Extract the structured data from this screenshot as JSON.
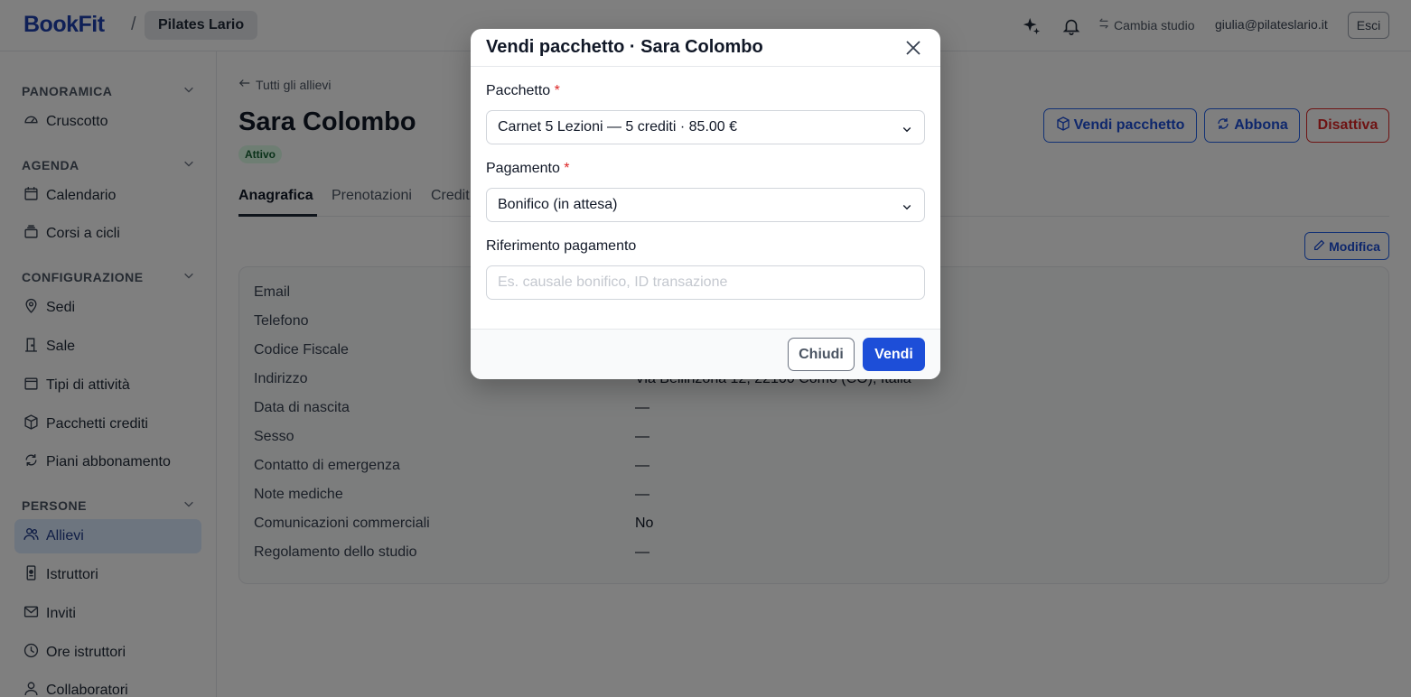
{
  "header": {
    "brand": "BookFit",
    "separator": "/",
    "studio": "Pilates Lario",
    "switch_studio": "Cambia studio",
    "user_email": "giulia@pilateslario.it",
    "logout": "Esci"
  },
  "sidebar": {
    "sections": [
      {
        "title": "PANORAMICA",
        "items": [
          "Cruscotto"
        ]
      },
      {
        "title": "AGENDA",
        "items": [
          "Calendario",
          "Corsi a cicli"
        ]
      },
      {
        "title": "CONFIGURAZIONE",
        "items": [
          "Sedi",
          "Sale",
          "Tipi di attività",
          "Pacchetti crediti",
          "Piani abbonamento"
        ]
      },
      {
        "title": "PERSONE",
        "items": [
          "Allievi",
          "Istruttori",
          "Inviti",
          "Ore istruttori",
          "Collaboratori"
        ]
      }
    ],
    "active_item": "Allievi"
  },
  "main": {
    "back_link": "Tutti gli allievi",
    "person_name": "Sara Colombo",
    "status": "Attivo",
    "actions": {
      "sell_package": "Vendi pacchetto",
      "subscribe": "Abbona",
      "deactivate": "Disattiva"
    },
    "tabs": [
      "Anagrafica",
      "Prenotazioni",
      "Credit"
    ],
    "edit": "Modifica",
    "details": [
      {
        "label": "Email",
        "value": ""
      },
      {
        "label": "Telefono",
        "value": ""
      },
      {
        "label": "Codice Fiscale",
        "value": ""
      },
      {
        "label": "Indirizzo",
        "value": "Via Bellinzona 12, 22100 Como (CO), Italia"
      },
      {
        "label": "Data di nascita",
        "value": "—"
      },
      {
        "label": "Sesso",
        "value": "—"
      },
      {
        "label": "Contatto di emergenza",
        "value": "—"
      },
      {
        "label": "Note mediche",
        "value": "—"
      },
      {
        "label": "Comunicazioni commerciali",
        "value": "No"
      },
      {
        "label": "Regolamento dello studio",
        "value": "—"
      }
    ]
  },
  "modal": {
    "title": "Vendi pacchetto · Sara Colombo",
    "package_label": "Pacchetto",
    "package_value": "Carnet 5 Lezioni — 5 crediti · 85.00 €",
    "payment_label": "Pagamento",
    "payment_value": "Bonifico (in attesa)",
    "reference_label": "Riferimento pagamento",
    "reference_placeholder": "Es. causale bonifico, ID transazione",
    "reference_value": "",
    "required_mark": "*",
    "close_button": "Chiudi",
    "submit_button": "Vendi"
  },
  "colors": {
    "brand": "#1e40af",
    "primary": "#1d4ed8",
    "danger": "#dc2626",
    "active_nav_bg": "#dbeafe",
    "badge_bg": "#dcfce7"
  }
}
